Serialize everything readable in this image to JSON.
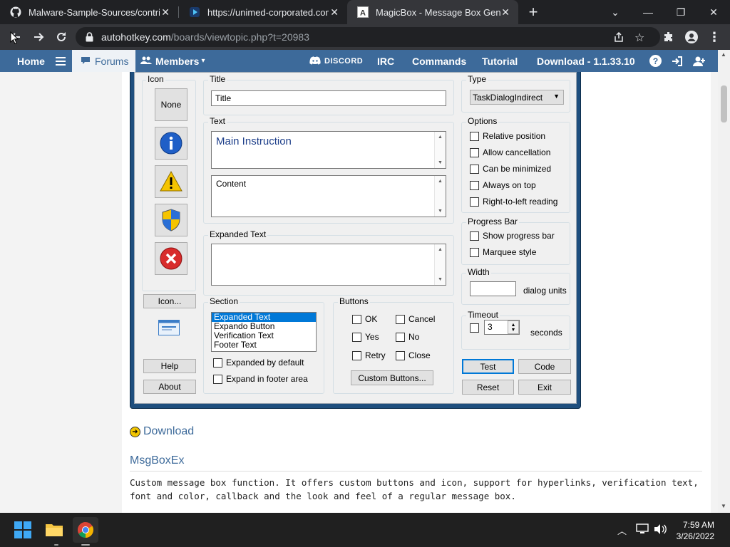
{
  "browser": {
    "tabs": [
      {
        "title": "Malware-Sample-Sources/contrib",
        "icon": "github-icon"
      },
      {
        "title": "https://unimed-corporated.com/",
        "icon": "play-icon"
      },
      {
        "title": "MagicBox - Message Box Genera",
        "icon": "autohotkey-icon",
        "active": true
      }
    ],
    "new_tab": "+",
    "url_host": "autohotkey.com",
    "url_path": "/boards/viewtopic.php?t=20983"
  },
  "site_nav": {
    "home": "Home",
    "forums": "Forums",
    "members": "Members",
    "discord": "DISCORD",
    "irc": "IRC",
    "commands": "Commands",
    "tutorial": "Tutorial",
    "download": "Download - 1.1.33.10"
  },
  "magicbox": {
    "icon_group": "Icon",
    "icon_none": "None",
    "icon_button": "Icon...",
    "help": "Help",
    "about": "About",
    "title_group": "Title",
    "title_value": "Title",
    "text_group": "Text",
    "main_instruction": "Main Instruction",
    "content": "Content",
    "expanded_group": "Expanded Text",
    "section_group": "Section",
    "section_items": [
      "Expanded Text",
      "Expando Button",
      "Verification Text",
      "Footer Text"
    ],
    "expanded_by_default": "Expanded by default",
    "expand_in_footer": "Expand in footer area",
    "buttons_group": "Buttons",
    "btn_ok": "OK",
    "btn_cancel": "Cancel",
    "btn_yes": "Yes",
    "btn_no": "No",
    "btn_retry": "Retry",
    "btn_close": "Close",
    "custom_buttons": "Custom Buttons...",
    "type_group": "Type",
    "type_value": "TaskDialogIndirect",
    "options_group": "Options",
    "options": [
      "Relative position",
      "Allow cancellation",
      "Can be minimized",
      "Always on top",
      "Right-to-left reading"
    ],
    "progress_group": "Progress Bar",
    "progress_options": [
      "Show progress bar",
      "Marquee style"
    ],
    "width_group": "Width",
    "width_unit": "dialog units",
    "timeout_group": "Timeout",
    "timeout_value": "3",
    "timeout_unit": "seconds",
    "test": "Test",
    "code": "Code",
    "reset": "Reset",
    "exit": "Exit"
  },
  "page": {
    "download_link": "Download",
    "section_title": "MsgBoxEx",
    "description": "Custom message box function. It offers custom buttons and icon, support for hyperlinks, verification text, font and color, callback and the look and feel of a regular message box."
  },
  "taskbar": {
    "time": "7:59 AM",
    "date": "3/26/2022"
  }
}
